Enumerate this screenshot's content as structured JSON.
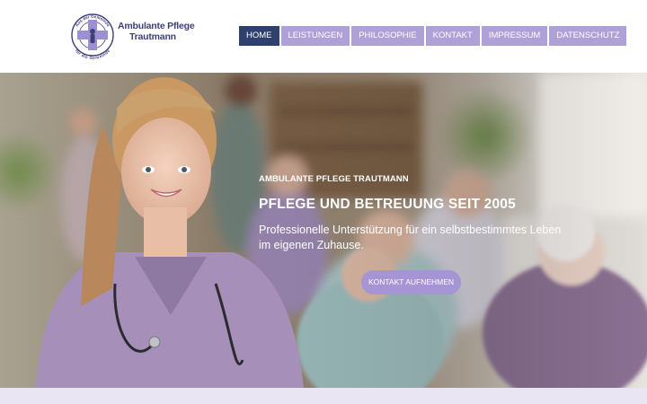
{
  "logo": {
    "line1": "Ambulante Pflege",
    "line2": "Trautmann",
    "arc_top": "Aus der Gemeinde",
    "arc_bottom": "für die Gemeinde"
  },
  "nav": {
    "items": [
      {
        "label": "HOME",
        "active": true
      },
      {
        "label": "LEISTUNGEN",
        "active": false
      },
      {
        "label": "PHILOSOPHIE",
        "active": false
      },
      {
        "label": "KONTAKT",
        "active": false
      },
      {
        "label": "IMPRESSUM",
        "active": false
      },
      {
        "label": "DATENSCHUTZ",
        "active": false
      }
    ]
  },
  "hero": {
    "eyebrow": "AMBULANTE PFLEGE TRAUTMANN",
    "headline": "PFLEGE UND BETREUUNG SEIT 2005",
    "subline": "Professionelle Unterstützung für ein selbstbestimmtes Leben im eigenen Zuhause.",
    "cta_label": "KONTAKT AUFNEHMEN"
  },
  "colors": {
    "nav_active": "#2f3f6e",
    "nav_inactive": "#b0a0d8",
    "button": "#a694d4",
    "brand_text": "#3d3f7a",
    "footer_strip": "#e9e5f3"
  }
}
